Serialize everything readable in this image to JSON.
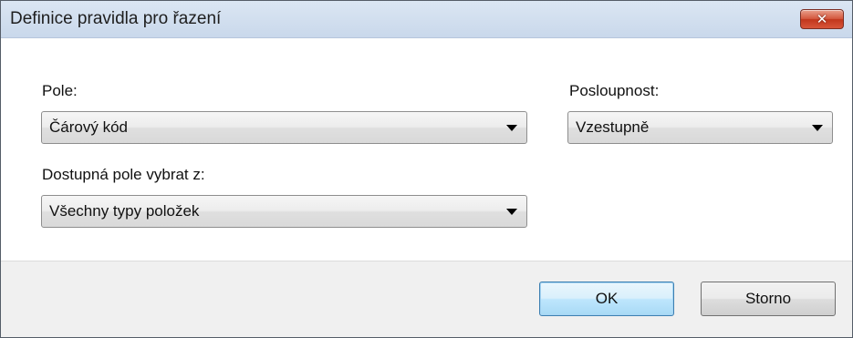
{
  "window": {
    "title": "Definice pravidla pro řazení",
    "close_glyph": "✕"
  },
  "fields": {
    "field_label": "Pole:",
    "field_value": "Čárový kód",
    "order_label": "Posloupnost:",
    "order_value": "Vzestupně",
    "source_label": "Dostupná pole vybrat z:",
    "source_value": "Všechny typy položek"
  },
  "buttons": {
    "ok_label": "OK",
    "cancel_label": "Storno"
  },
  "colors": {
    "close_button": "#c1361c",
    "default_button_border": "#3c7fb1",
    "titlebar": "#c9d8eb"
  }
}
